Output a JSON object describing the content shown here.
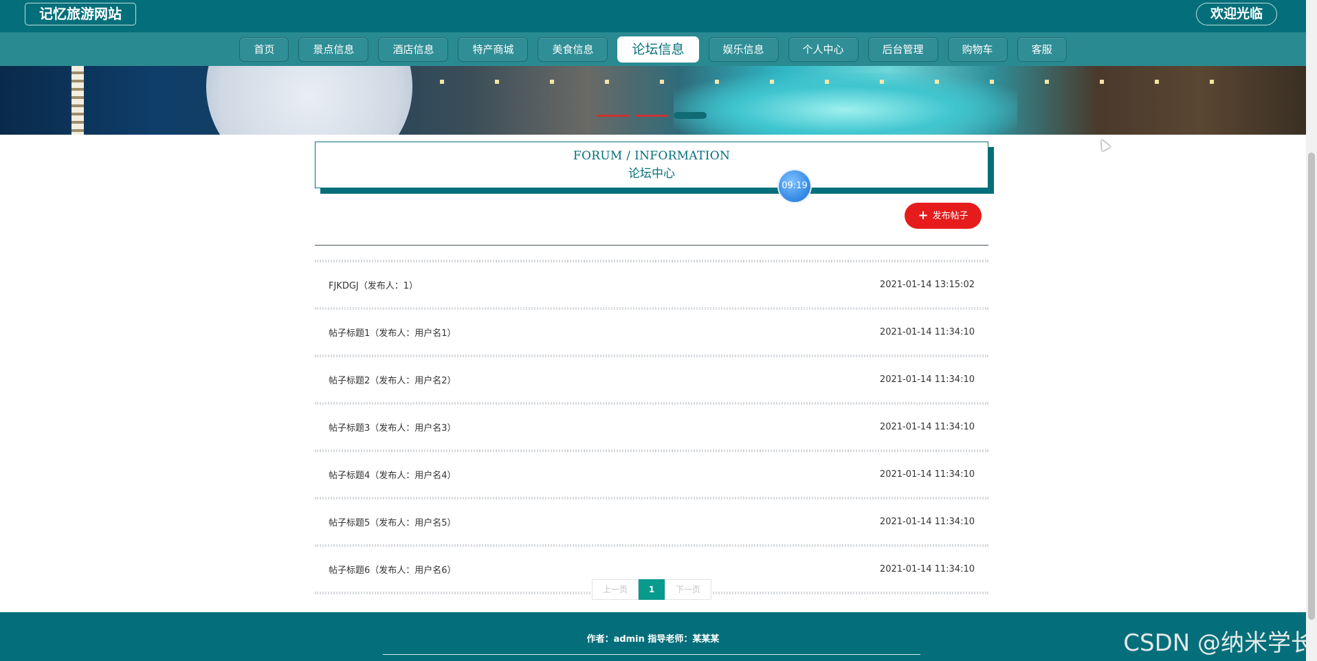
{
  "header": {
    "site_title": "记忆旅游网站",
    "welcome": "欢迎光临"
  },
  "nav": {
    "items": [
      {
        "label": "首页",
        "active": false
      },
      {
        "label": "景点信息",
        "active": false
      },
      {
        "label": "酒店信息",
        "active": false
      },
      {
        "label": "特产商城",
        "active": false
      },
      {
        "label": "美食信息",
        "active": false
      },
      {
        "label": "论坛信息",
        "active": true
      },
      {
        "label": "娱乐信息",
        "active": false
      },
      {
        "label": "个人中心",
        "active": false
      },
      {
        "label": "后台管理",
        "active": false
      },
      {
        "label": "购物车",
        "active": false
      },
      {
        "label": "客服",
        "active": false
      }
    ]
  },
  "section": {
    "title_en": "FORUM / INFORMATION",
    "title_zh": "论坛中心",
    "clock": "09:19"
  },
  "actions": {
    "post_label": "发布帖子",
    "post_icon": "plus-icon"
  },
  "posts": [
    {
      "title": "FJKDGJ（发布人：1）",
      "time": "2021-01-14 13:15:02"
    },
    {
      "title": "帖子标题1（发布人：用户名1）",
      "time": "2021-01-14 11:34:10"
    },
    {
      "title": "帖子标题2（发布人：用户名2）",
      "time": "2021-01-14 11:34:10"
    },
    {
      "title": "帖子标题3（发布人：用户名3）",
      "time": "2021-01-14 11:34:10"
    },
    {
      "title": "帖子标题4（发布人：用户名4）",
      "time": "2021-01-14 11:34:10"
    },
    {
      "title": "帖子标题5（发布人：用户名5）",
      "time": "2021-01-14 11:34:10"
    },
    {
      "title": "帖子标题6（发布人：用户名6）",
      "time": "2021-01-14 11:34:10"
    }
  ],
  "pagination": {
    "prev": "上一页",
    "current": "1",
    "next": "下一页"
  },
  "footer": {
    "credits": "作者：admin 指导老师：某某某"
  },
  "watermark": "CSDN @纳米学长",
  "colors": {
    "primary": "#046f7a",
    "nav_bg": "#2a8a92",
    "post_button": "#e61c1c",
    "page_active": "#089a8c"
  }
}
